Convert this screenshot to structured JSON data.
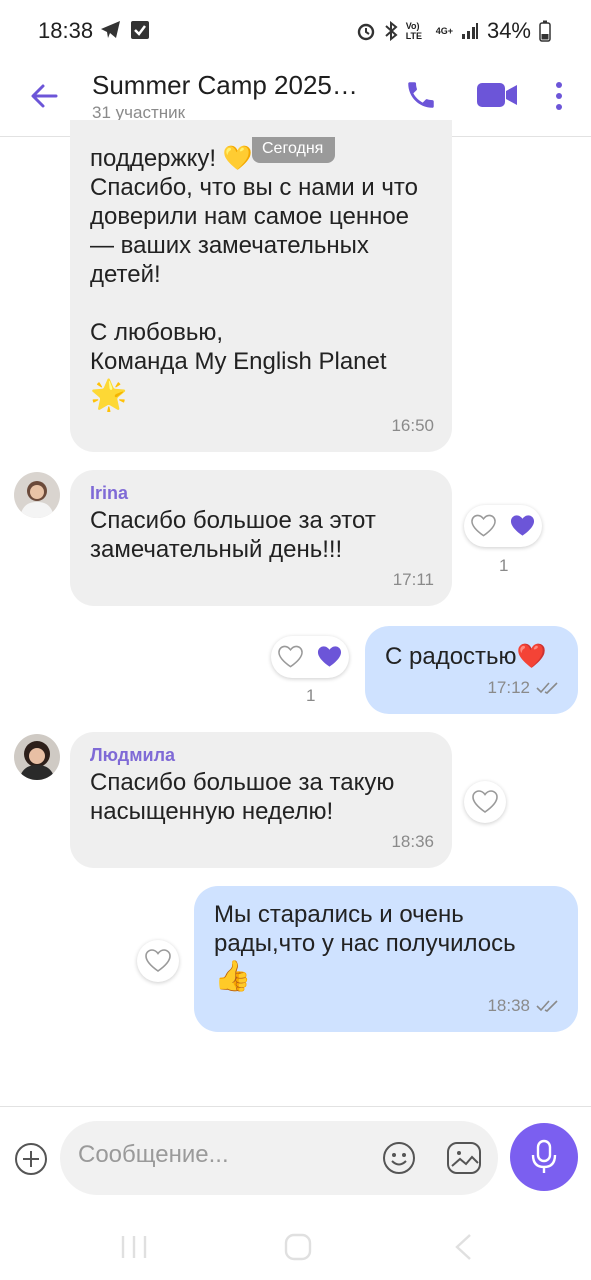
{
  "status_bar": {
    "time": "18:38",
    "network_label": "4G+",
    "volte_label": "Vo) LTE",
    "battery": "34%"
  },
  "header": {
    "title": "Summer Camp 2025…",
    "subtitle": "31 участник"
  },
  "date_chip": "Сегодня",
  "messages": [
    {
      "direction": "in",
      "lines": [
        "поддержку! 💛",
        "Спасибо, что вы с нами и что",
        "доверили нам самое ценное",
        "— ваших замечательных",
        "детей!",
        "",
        "С любовью,",
        "Команда My English Planet",
        "🌟"
      ],
      "time": "16:50"
    },
    {
      "direction": "in",
      "sender": "Irina",
      "lines": [
        "Спасибо большое за этот",
        "замечательный день!!!"
      ],
      "time": "17:11",
      "reaction_count": "1"
    },
    {
      "direction": "out",
      "lines": [
        "С радостью❤️"
      ],
      "time": "17:12",
      "reaction_count": "1"
    },
    {
      "direction": "in",
      "sender": "Людмила",
      "lines": [
        "Спасибо большое за такую",
        "насыщенную неделю!"
      ],
      "time": "18:36"
    },
    {
      "direction": "out",
      "lines": [
        "Мы старались и очень",
        "рады,что у нас получилось",
        "👍"
      ],
      "time": "18:38"
    }
  ],
  "composer": {
    "placeholder": "Сообщение..."
  },
  "colors": {
    "accent": "#7b5ff0",
    "incoming_bubble": "#efefef",
    "outgoing_bubble": "#cfe2ff",
    "sender_name": "#7f6ad6"
  },
  "icons": [
    "back-arrow-icon",
    "phone-icon",
    "video-icon",
    "more-vert-icon",
    "heart-icon",
    "plus-icon",
    "emoji-icon",
    "sticker-icon",
    "mic-icon",
    "double-check-icon"
  ]
}
